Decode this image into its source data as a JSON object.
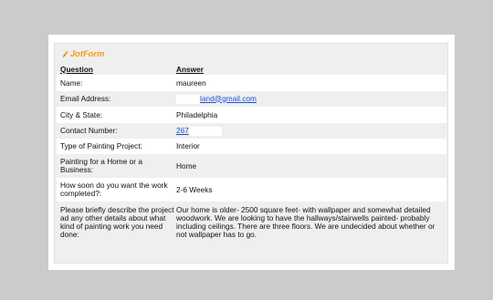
{
  "brand": {
    "name": "JotForm"
  },
  "table": {
    "header": {
      "question": "Question",
      "answer": "Answer"
    },
    "rows": [
      {
        "question": "Name:",
        "answer": "maureen",
        "type": "text"
      },
      {
        "question": "Email Address:",
        "answer": "land@gmail.com",
        "type": "link"
      },
      {
        "question": "City & State:",
        "answer": "Philadelphia",
        "type": "text"
      },
      {
        "question": "Contact Number:",
        "answer": "267",
        "type": "link"
      },
      {
        "question": "Type of Painting Project:",
        "answer": "Interior",
        "type": "text"
      },
      {
        "question": "Painting for a Home or a Business:",
        "answer": "Home",
        "type": "text"
      },
      {
        "question": "How soon do you want the work completed?:",
        "answer": "2-6 Weeks",
        "type": "text"
      },
      {
        "question": "Please briefly describe the project ad any other details about what kind of painting work you need done:",
        "answer": "Our home is older- 2500 square feet- with wallpaper and somewhat detailed woodwork. We are looking to have the hallways/stairwells painted- probably including ceilings. There are three floors. We are undecided about whether or not wallpaper has to go.",
        "type": "text"
      }
    ]
  }
}
